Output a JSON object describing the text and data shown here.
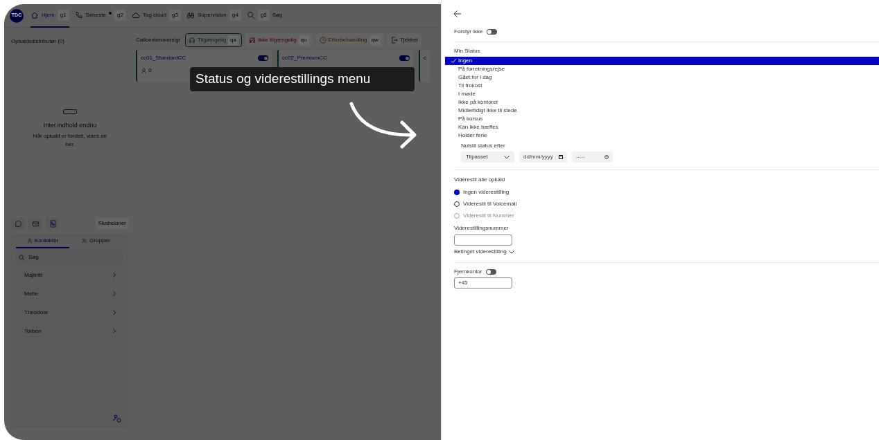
{
  "app": {
    "logo": "TDC",
    "nav": [
      {
        "label": "Hjem",
        "shortcut": "g1",
        "selected": true,
        "badge": false
      },
      {
        "label": "Seneste",
        "shortcut": "g2",
        "selected": false,
        "badge": true
      },
      {
        "label": "Tag cloud",
        "shortcut": "g3",
        "selected": false,
        "badge": false
      },
      {
        "label": "Supervision",
        "shortcut": "g4",
        "selected": false,
        "badge": false
      },
      {
        "label": "Søg",
        "shortcut": "g5",
        "selected": false,
        "badge": false
      }
    ],
    "distributor": {
      "title": "Opkaldsdistributør (0)",
      "empty_title": "Intet indhold endnu",
      "empty_text": "Når opkald er fordelt, vises de her."
    },
    "callcenter": {
      "label": "Callcenteroversigt",
      "statuses": [
        {
          "kind": "available",
          "label": "Tilgængelig",
          "shortcut": "qa",
          "selected": true
        },
        {
          "kind": "unavailable",
          "label": "Ikke tilgængelig",
          "shortcut": "qu",
          "selected": false
        },
        {
          "kind": "aftercall",
          "label": "Efterbehandling",
          "shortcut": "qw",
          "selected": false
        },
        {
          "kind": "checkout",
          "label": "Tjekket",
          "selected": false
        }
      ],
      "queues": [
        {
          "name": "cc01_StandardCC",
          "on": true,
          "agents": "0"
        },
        {
          "name": "cc02_PremiumCC",
          "on": true
        },
        {
          "name": "c"
        }
      ]
    },
    "actions": [
      {
        "selected": false
      },
      {
        "selected": false
      },
      {
        "selected": true
      }
    ],
    "templates_button": "Skabeloner",
    "tabs": [
      {
        "label": "Kontakter",
        "selected": true
      },
      {
        "label": "Grupper",
        "selected": false
      }
    ],
    "search": {
      "placeholder": "Søg"
    },
    "contacts": [
      "Majbritt",
      "Mette",
      "Theodore",
      "Torben"
    ]
  },
  "callout": {
    "text": "Status og viderestillings menu"
  },
  "panel": {
    "do_not_disturb": {
      "label": "Forstyr ikke",
      "on": false
    },
    "status_title": "Min Status",
    "statuses": [
      {
        "label": "Ingen",
        "selected": true
      },
      {
        "label": "På forretningsrejse",
        "selected": false
      },
      {
        "label": "Gået for i dag",
        "selected": false
      },
      {
        "label": "Til frokost",
        "selected": false
      },
      {
        "label": "I møde",
        "selected": false
      },
      {
        "label": "Ikke på kontoret",
        "selected": false
      },
      {
        "label": "Midlertidigt ikke til stede",
        "selected": false
      },
      {
        "label": "På kursus",
        "selected": false
      },
      {
        "label": "Kan ikke træffes",
        "selected": false
      },
      {
        "label": "Holder ferie",
        "selected": false
      }
    ],
    "reset": {
      "label": "Nulstil status efter",
      "select": "Tilpasset",
      "date_placeholder": "dd/mm/yyyy",
      "time_placeholder": "--:--"
    },
    "forward": {
      "title": "Viderestil alle opkald",
      "options": [
        {
          "label": "Ingen viderestilling",
          "selected": true,
          "disabled": false
        },
        {
          "label": "Viderestil til Voicemail",
          "selected": false,
          "disabled": false
        },
        {
          "label": "Viderestil til Nummer",
          "selected": false,
          "disabled": true
        }
      ],
      "number_label": "Viderestillingsnummer",
      "conditional": {
        "label": "Betinget viderestilling",
        "expanded": false
      }
    },
    "remote_office": {
      "label": "Fjernkontor",
      "on": false,
      "value": "+45"
    }
  }
}
